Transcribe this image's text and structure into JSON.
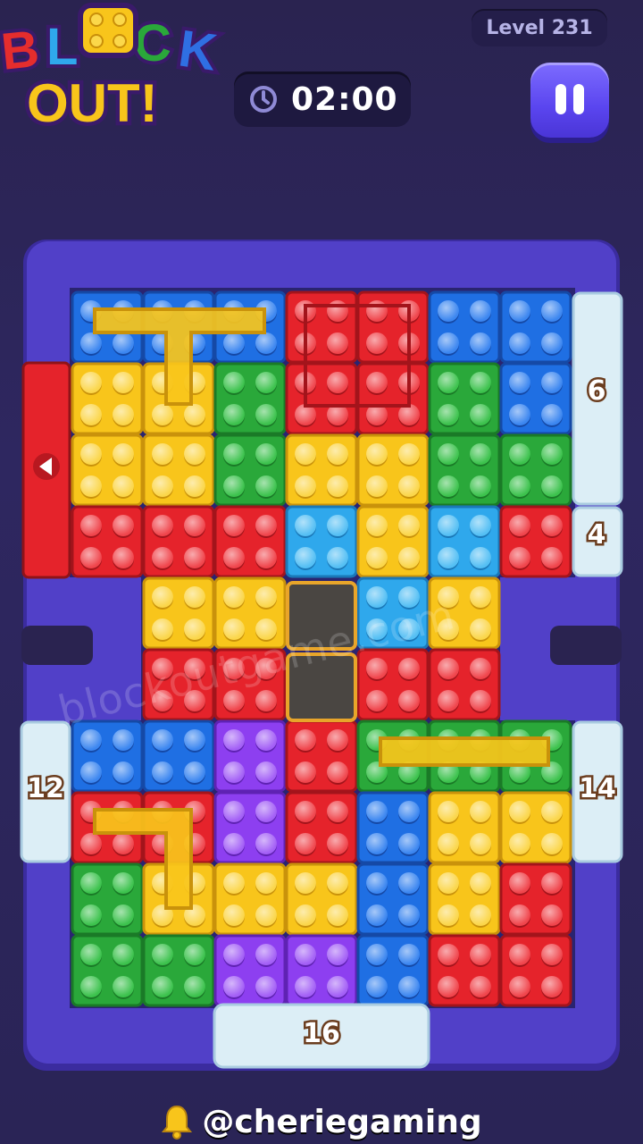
{
  "header": {
    "logo_line1": "BLOCK",
    "logo_line2": "OUT!",
    "level_label": "Level 231",
    "timer_value": "02:00"
  },
  "icons": {
    "timer": "clock-icon",
    "pause": "pause-icon",
    "exit": "arrow-left-icon",
    "footer": "bell-icon"
  },
  "gates": {
    "right_top": "6",
    "right_mid": "4",
    "left_bottom": "12",
    "right_bottom": "14",
    "bottom": "16"
  },
  "watermark": "blockoutgame.com",
  "footer": {
    "handle": "@cheriegaming"
  },
  "colors": {
    "red": "#e5232b",
    "blue": "#1f6fe3",
    "yellow": "#f8c51b",
    "green": "#2aa83a",
    "cyan": "#2fa8ec",
    "purple": "#8d3ff0",
    "board": "#5140c8",
    "gate_ice": "#dceef6"
  }
}
